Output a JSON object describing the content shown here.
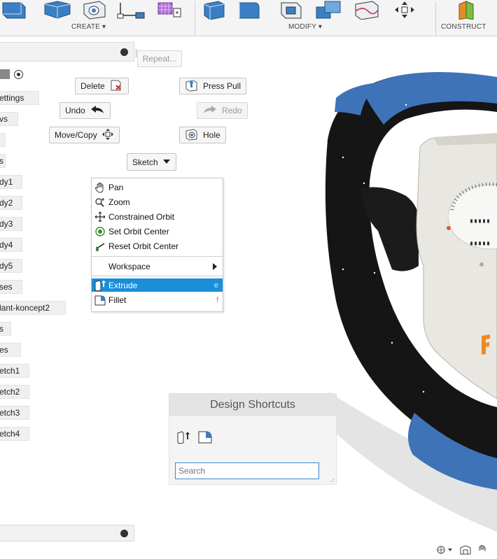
{
  "toolbar": {
    "groups": [
      {
        "label": "CREATE ▾"
      },
      {
        "label": "MODIFY ▾"
      },
      {
        "label": "CONSTRUCT"
      }
    ]
  },
  "browser": {
    "items": [
      "ettings",
      "vs",
      "",
      "s",
      "dy1",
      "dy2",
      "dy3",
      "dy4",
      "dy5",
      "ses",
      "lant-koncept2",
      "s",
      "es",
      "etch1",
      "etch2",
      "etch3",
      "etch4"
    ]
  },
  "marking_menu": {
    "repeat": "Repeat...",
    "delete": "Delete",
    "press_pull": "Press Pull",
    "undo": "Undo",
    "redo": "Redo",
    "move_copy": "Move/Copy",
    "hole": "Hole",
    "sketch": "Sketch"
  },
  "context_menu": {
    "items": [
      {
        "label": "Pan",
        "icon": "hand-icon"
      },
      {
        "label": "Zoom",
        "icon": "zoom-icon"
      },
      {
        "label": "Constrained Orbit",
        "icon": "orbit-icon"
      },
      {
        "label": "Set Orbit Center",
        "icon": "target-icon"
      },
      {
        "label": "Reset Orbit Center",
        "icon": "reset-icon"
      }
    ],
    "workspace": "Workspace",
    "extrude": {
      "label": "Extrude",
      "shortcut": "e"
    },
    "fillet": {
      "label": "Fillet",
      "shortcut": "f"
    }
  },
  "design_shortcuts": {
    "title": "Design Shortcuts",
    "search_placeholder": "Search"
  },
  "colors": {
    "accent": "#1a8fd8",
    "toolbar_blue": "#3a7fc4",
    "grip_blue": "#3e73b8",
    "grip_black": "#1a1a1a"
  }
}
